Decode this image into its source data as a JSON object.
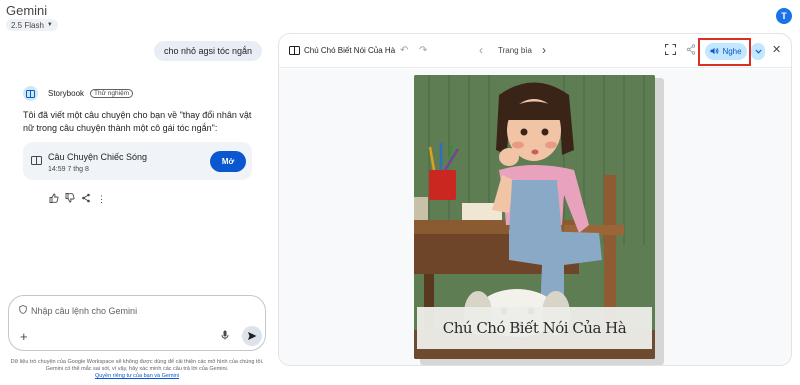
{
  "app": {
    "title": "Gemini",
    "model": "2.5 Flash",
    "avatar_letter": "T"
  },
  "chat": {
    "user_message": "cho nhỏ agsi tóc ngắn",
    "tool_name": "Storybook",
    "tool_badge": "Thử nghiệm",
    "response_text": "Tôi đã viết một câu chuyện cho bạn về \"thay đổi nhân vật nữ trong câu chuyện thành một cô gái tóc ngắn\":",
    "story_card": {
      "title": "Câu Chuyện Chiếc Sóng",
      "timestamp": "14:59 7 thg 8",
      "open_label": "Mở"
    }
  },
  "input": {
    "placeholder": "Nhập câu lệnh cho Gemini"
  },
  "disclaimer": {
    "text": "Dữ liệu trò chuyện của Google Workspace sẽ không được dùng để cải thiện các mô hình của chúng tôi. Gemini có thể mắc sai sót, vì vậy, hãy xác minh các câu trả lời của Gemini.",
    "link": "Quyền riêng tư của bạn và Gemini"
  },
  "panel": {
    "title": "Chú Chó Biết Nói Của Hà",
    "page_label": "Trang bìa",
    "listen_label": "Nghe",
    "cover_title": "Chú Chó Biết Nói Của Hà"
  },
  "colors": {
    "accent": "#0b57d0",
    "listen_bg": "#c2e7ff",
    "highlight": "#d93025"
  }
}
